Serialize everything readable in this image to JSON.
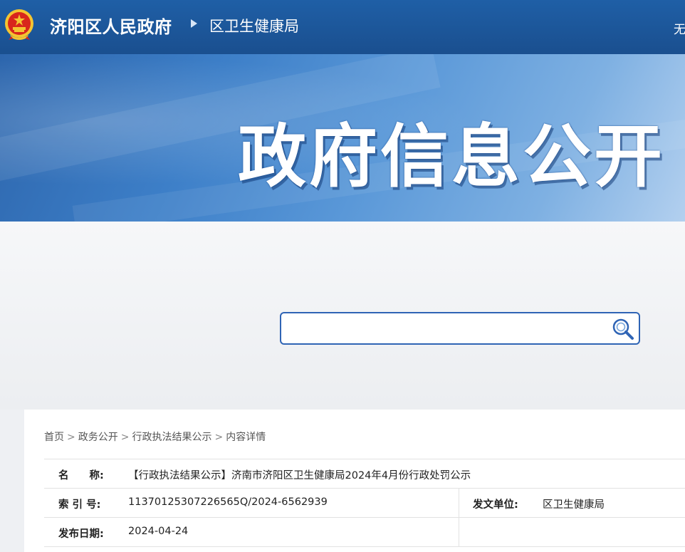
{
  "header": {
    "site_name": "济阳区人民政府",
    "dept_name": "区卫生健康局",
    "right_text": "无"
  },
  "banner": {
    "title": "政府信息公开"
  },
  "search": {
    "placeholder": ""
  },
  "breadcrumb": {
    "items": [
      "首页",
      "政务公开",
      "行政执法结果公示",
      "内容详情"
    ],
    "separator": ">"
  },
  "info": {
    "name_label": "名　　称:",
    "name_value": "【行政执法结果公示】济南市济阳区卫生健康局2024年4月份行政处罚公示",
    "index_label": "索 引 号:",
    "index_value": "11370125307226565Q/2024-6562939",
    "issuer_label": "发文单位:",
    "issuer_value": "区卫生健康局",
    "date_label": "发布日期:",
    "date_value": "2024-04-24"
  },
  "colors": {
    "header_bg": "#1f5fa6",
    "accent": "#2f64b5",
    "emblem_red": "#d8261c",
    "emblem_gold": "#f4c531"
  }
}
